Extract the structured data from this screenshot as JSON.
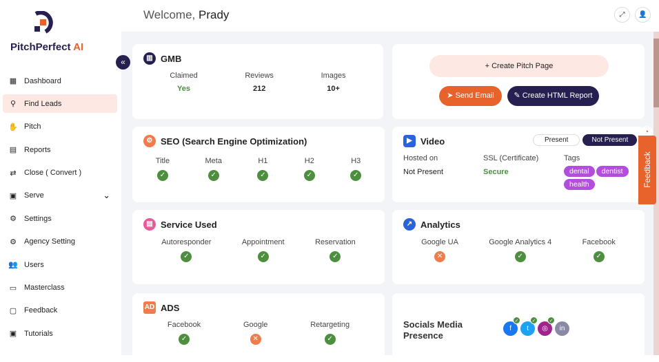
{
  "brand": {
    "name": "PitchPerfect",
    "suffix": "AI"
  },
  "header": {
    "welcome": "Welcome,",
    "user": "Prady"
  },
  "sidebar": {
    "items": [
      {
        "label": "Dashboard",
        "icon": "grid-icon"
      },
      {
        "label": "Find Leads",
        "icon": "search-icon",
        "active": true
      },
      {
        "label": "Pitch",
        "icon": "hand-icon"
      },
      {
        "label": "Reports",
        "icon": "document-icon"
      },
      {
        "label": "Close ( Convert )",
        "icon": "swap-icon"
      },
      {
        "label": "Serve",
        "icon": "serve-icon"
      },
      {
        "label": "Settings",
        "icon": "gear-icon"
      },
      {
        "label": "Agency Setting",
        "icon": "gears-icon"
      },
      {
        "label": "Users",
        "icon": "users-icon"
      },
      {
        "label": "Masterclass",
        "icon": "monitor-icon"
      },
      {
        "label": "Feedback",
        "icon": "chat-icon"
      },
      {
        "label": "Tutorials",
        "icon": "video-icon"
      }
    ]
  },
  "gmb": {
    "title": "GMB",
    "cols": [
      {
        "label": "Claimed",
        "value": "Yes"
      },
      {
        "label": "Reviews",
        "value": "212"
      },
      {
        "label": "Images",
        "value": "10+"
      }
    ]
  },
  "actions": {
    "create_pitch": "Create Pitch Page",
    "send_email": "Send Email",
    "create_report": "Create HTML Report"
  },
  "seo": {
    "title": "SEO (Search Engine Optimization)",
    "cols": [
      "Title",
      "Meta",
      "H1",
      "H2",
      "H3"
    ]
  },
  "video": {
    "title": "Video",
    "toggle": [
      "Present",
      "Not Present"
    ],
    "hosted_label": "Hosted on",
    "hosted_value": "Not Present",
    "ssl_label": "SSL (Certificate)",
    "ssl_value": "Secure",
    "tags_label": "Tags",
    "tags": [
      "dental",
      "dentist",
      "health"
    ]
  },
  "service": {
    "title": "Service Used",
    "cols": [
      "Autoresponder",
      "Appointment",
      "Reservation"
    ]
  },
  "analytics": {
    "title": "Analytics",
    "cols": [
      {
        "label": "Google UA",
        "ok": false
      },
      {
        "label": "Google Analytics 4",
        "ok": true
      },
      {
        "label": "Facebook",
        "ok": true
      }
    ]
  },
  "ads": {
    "title": "ADS",
    "cols": [
      {
        "label": "Facebook",
        "ok": true
      },
      {
        "label": "Google",
        "ok": false
      },
      {
        "label": "Retargeting",
        "ok": true
      }
    ]
  },
  "socials": {
    "title_line1": "Socials Media",
    "title_line2": "Presence"
  },
  "feedback_tab": "Feedback",
  "colors": {
    "navy": "#25204f",
    "orange": "#e8622c",
    "green": "#4d8f3f",
    "purple": "#b14fdb"
  }
}
